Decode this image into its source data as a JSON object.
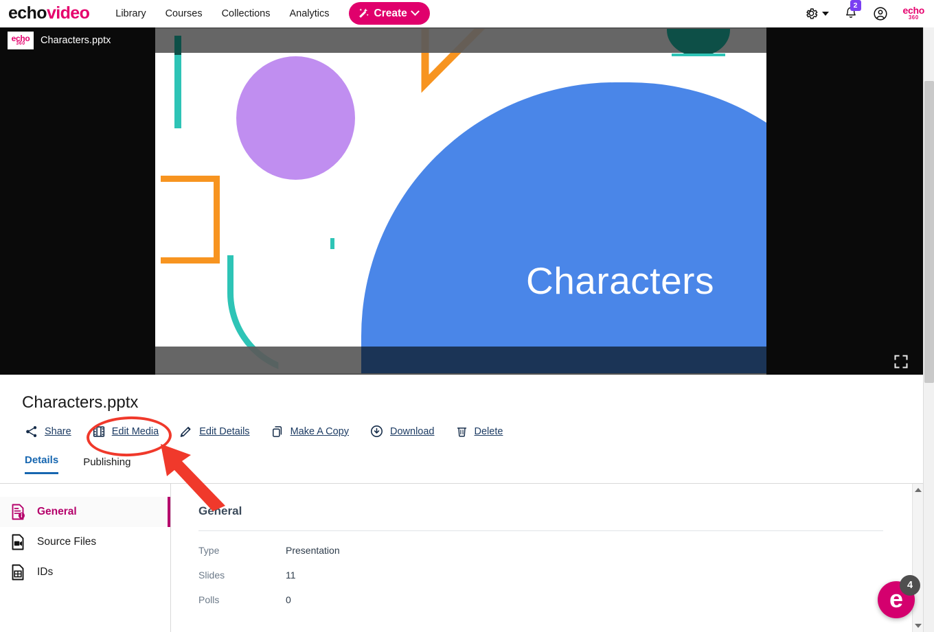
{
  "topnav": {
    "brand_echo": "echo",
    "brand_video": "video",
    "links": [
      {
        "label": "Library",
        "icon": "library-icon"
      },
      {
        "label": "Courses",
        "icon": "courses-icon"
      },
      {
        "label": "Collections",
        "icon": "collections-icon"
      },
      {
        "label": "Analytics",
        "icon": "analytics-icon"
      }
    ],
    "create_label": "Create",
    "create_icon": "magic-wand-icon",
    "create_color": "#e0006c",
    "settings_icon": "gear-icon",
    "notifications_icon": "bell-icon",
    "notifications_count": "2",
    "notifications_badge_color": "#7a3ff2",
    "account_icon": "account-circle-icon",
    "logo_right_top": "echo",
    "logo_right_bottom": "360"
  },
  "player": {
    "logo_top": "echo",
    "logo_bottom": "360",
    "filename": "Characters.pptx",
    "slide_title": "Characters",
    "fullscreen_icon": "fullscreen-icon",
    "colors": {
      "blue_blob": "#4a86e8",
      "navy_foot": "#1b3456",
      "purple_ellipse": "#c08ef0",
      "orange": "#f79420",
      "teal": "#2ec4b6",
      "dark_green": "#0d4f47",
      "overlay_band": "#5a5a5a"
    }
  },
  "detail": {
    "asset_title": "Characters.pptx",
    "actions": [
      {
        "label": "Share",
        "icon": "share-icon"
      },
      {
        "label": "Edit Media",
        "icon": "film-strip-icon"
      },
      {
        "label": "Edit Details",
        "icon": "pencil-icon"
      },
      {
        "label": "Make A Copy",
        "icon": "copy-icon"
      },
      {
        "label": "Download",
        "icon": "download-cloud-icon"
      },
      {
        "label": "Delete",
        "icon": "trash-icon"
      }
    ],
    "tabs": [
      {
        "label": "Details",
        "active": true
      },
      {
        "label": "Publishing",
        "active": false
      }
    ],
    "tab_accent_color": "#1666b0"
  },
  "sidebar": {
    "items": [
      {
        "label": "General",
        "icon": "document-info-icon",
        "active": true
      },
      {
        "label": "Source Files",
        "icon": "document-video-icon",
        "active": false
      },
      {
        "label": "IDs",
        "icon": "document-grid-icon",
        "active": false
      }
    ],
    "active_color": "#b5006b"
  },
  "content": {
    "heading": "General",
    "fields": [
      {
        "key": "Type",
        "value": "Presentation"
      },
      {
        "key": "Slides",
        "value": "11"
      },
      {
        "key": "Polls",
        "value": "0"
      }
    ]
  },
  "annotations": {
    "highlight_target": "Edit Media",
    "highlight_color": "#f0392b",
    "arrow_color": "#f0392b"
  },
  "help": {
    "glyph": "e",
    "badge_count": "4",
    "bubble_color": "#d4006e",
    "badge_color": "#4f4f4f"
  }
}
